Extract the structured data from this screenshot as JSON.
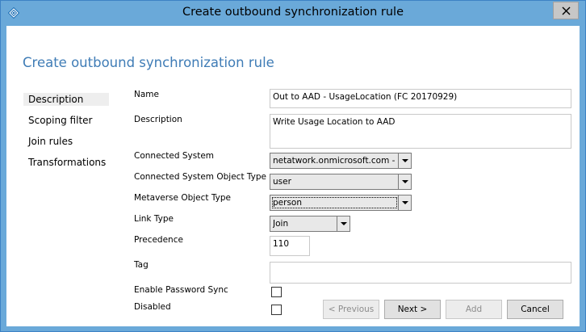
{
  "window": {
    "title": "Create outbound synchronization rule"
  },
  "page": {
    "heading": "Create outbound synchronization rule"
  },
  "nav": {
    "items": [
      {
        "label": "Description",
        "selected": true
      },
      {
        "label": "Scoping filter",
        "selected": false
      },
      {
        "label": "Join rules",
        "selected": false
      },
      {
        "label": "Transformations",
        "selected": false
      }
    ]
  },
  "form": {
    "name": {
      "label": "Name",
      "value": "Out to AAD - UsageLocation (FC 20170929)"
    },
    "description": {
      "label": "Description",
      "value": "Write Usage Location to AAD"
    },
    "connected_system": {
      "label": "Connected System",
      "value": "netatwork.onmicrosoft.com - AAD"
    },
    "connected_system_object_type": {
      "label": "Connected System Object Type",
      "value": "user"
    },
    "metaverse_object_type": {
      "label": "Metaverse Object Type",
      "value": "person"
    },
    "link_type": {
      "label": "Link Type",
      "value": "Join"
    },
    "precedence": {
      "label": "Precedence",
      "value": "110"
    },
    "tag": {
      "label": "Tag",
      "value": ""
    },
    "enable_password_sync": {
      "label": "Enable Password Sync",
      "checked": false
    },
    "disabled": {
      "label": "Disabled",
      "checked": false
    }
  },
  "buttons": {
    "previous": "< Previous",
    "next": "Next >",
    "add": "Add",
    "cancel": "Cancel"
  },
  "colors": {
    "title_bar": "#6aa9d9",
    "heading": "#3f7cb6"
  },
  "icons": {
    "app": "sync-diamond-icon",
    "close": "close-icon"
  }
}
